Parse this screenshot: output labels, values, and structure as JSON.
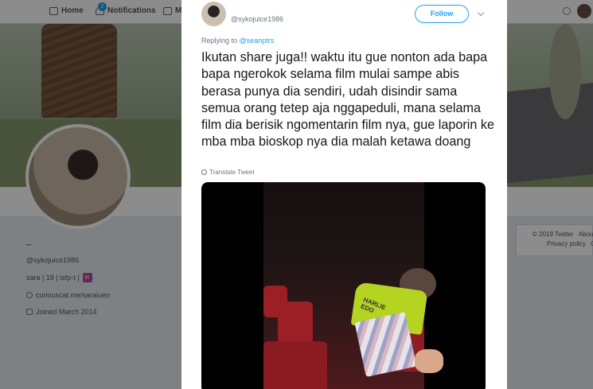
{
  "nav": {
    "home_label": "Home",
    "notifications_label": "Notifications",
    "notifications_count": "2",
    "messages_label": "M"
  },
  "profile": {
    "name": "_",
    "handle": "@sykojuice1986",
    "bio": "sara | 18 | isfp-t |",
    "bio_emoji": "♓",
    "link": "curiouscat.me/saraiueo",
    "joined": "Joined March 2014"
  },
  "footer": {
    "copyright": "© 2019 Twitter",
    "about": "About",
    "privacy": "Privacy policy",
    "cookies": "C"
  },
  "tweet": {
    "handle": "@sykojuice1986",
    "follow_label": "Follow",
    "replying_prefix": "Replying to",
    "replying_to": "@seanptrs",
    "text": "Ikutan share juga!! waktu itu gue nonton ada bapa bapa ngerokok selama film mulai sampe abis berasa punya dia sendiri, udah disindir sama semua orang tetep aja nggapeduli, mana selama film dia berisik ngomentarin film nya, gue laporin ke mba mba bioskop nya dia malah ketawa doang",
    "translate_label": "Translate Tweet",
    "shirt_text": "HARLIE\nEDO"
  },
  "colors": {
    "accent": "#1da1f2",
    "overlay": "rgba(0,0,0,0.45)"
  },
  "icons": [
    "home-icon",
    "bell-icon",
    "mail-icon",
    "search-icon",
    "caret-down-icon",
    "globe-icon",
    "link-icon",
    "calendar-icon"
  ]
}
